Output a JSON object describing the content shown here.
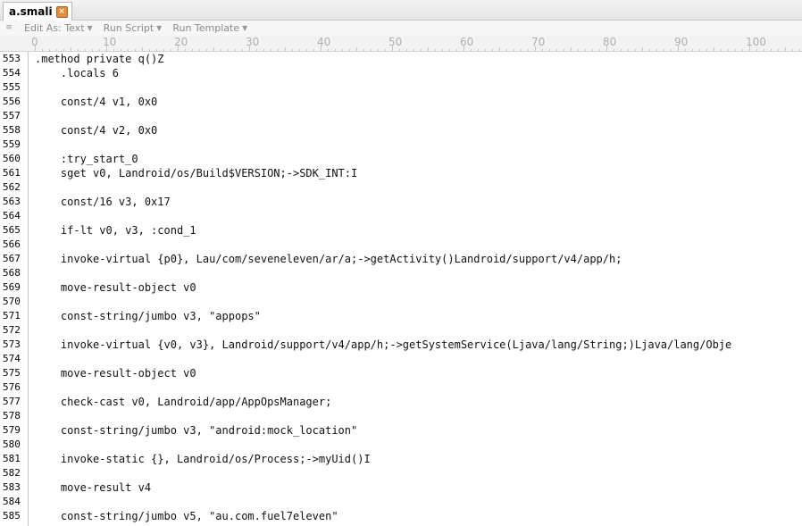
{
  "tab": {
    "label": "a.smali",
    "close_icon": "close-icon"
  },
  "toolbar": {
    "edit_as": "Edit As: Text",
    "run_script": "Run Script",
    "run_template": "Run Template"
  },
  "ruler": [
    "0",
    "10",
    "20",
    "30",
    "40",
    "50",
    "60",
    "70",
    "80",
    "90",
    "100"
  ],
  "lines": [
    {
      "n": "553",
      "t": ".method private q()Z"
    },
    {
      "n": "554",
      "t": "    .locals 6"
    },
    {
      "n": "555",
      "t": ""
    },
    {
      "n": "556",
      "t": "    const/4 v1, 0x0"
    },
    {
      "n": "557",
      "t": ""
    },
    {
      "n": "558",
      "t": "    const/4 v2, 0x0"
    },
    {
      "n": "559",
      "t": ""
    },
    {
      "n": "560",
      "t": "    :try_start_0"
    },
    {
      "n": "561",
      "t": "    sget v0, Landroid/os/Build$VERSION;->SDK_INT:I"
    },
    {
      "n": "562",
      "t": ""
    },
    {
      "n": "563",
      "t": "    const/16 v3, 0x17"
    },
    {
      "n": "564",
      "t": ""
    },
    {
      "n": "565",
      "t": "    if-lt v0, v3, :cond_1"
    },
    {
      "n": "566",
      "t": ""
    },
    {
      "n": "567",
      "t": "    invoke-virtual {p0}, Lau/com/seveneleven/ar/a;->getActivity()Landroid/support/v4/app/h;"
    },
    {
      "n": "568",
      "t": ""
    },
    {
      "n": "569",
      "t": "    move-result-object v0"
    },
    {
      "n": "570",
      "t": ""
    },
    {
      "n": "571",
      "t": "    const-string/jumbo v3, \"appops\""
    },
    {
      "n": "572",
      "t": ""
    },
    {
      "n": "573",
      "t": "    invoke-virtual {v0, v3}, Landroid/support/v4/app/h;->getSystemService(Ljava/lang/String;)Ljava/lang/Obje"
    },
    {
      "n": "574",
      "t": ""
    },
    {
      "n": "575",
      "t": "    move-result-object v0"
    },
    {
      "n": "576",
      "t": ""
    },
    {
      "n": "577",
      "t": "    check-cast v0, Landroid/app/AppOpsManager;"
    },
    {
      "n": "578",
      "t": ""
    },
    {
      "n": "579",
      "t": "    const-string/jumbo v3, \"android:mock_location\""
    },
    {
      "n": "580",
      "t": ""
    },
    {
      "n": "581",
      "t": "    invoke-static {}, Landroid/os/Process;->myUid()I"
    },
    {
      "n": "582",
      "t": ""
    },
    {
      "n": "583",
      "t": "    move-result v4"
    },
    {
      "n": "584",
      "t": ""
    },
    {
      "n": "585",
      "t": "    const-string/jumbo v5, \"au.com.fuel7eleven\""
    }
  ]
}
